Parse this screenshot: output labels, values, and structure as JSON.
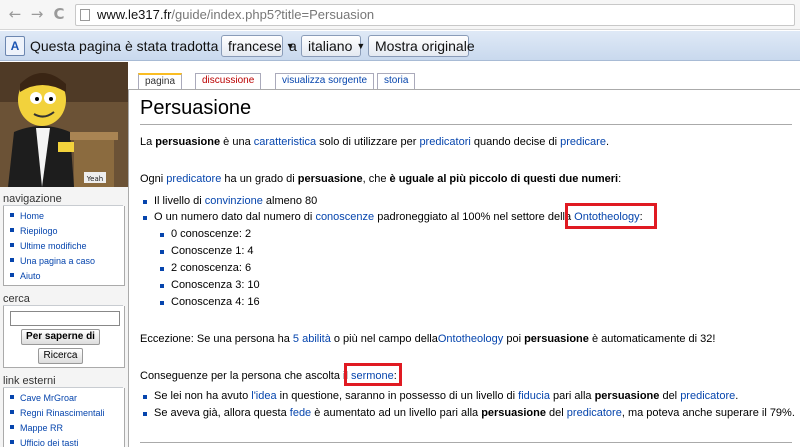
{
  "browser": {
    "back_icon": "←",
    "forward_icon": "→",
    "reload_icon": "C",
    "url_host": "www.le317.fr",
    "url_path": "/guide/index.php5?title=Persuasion"
  },
  "translate_bar": {
    "text": "Questa pagina è stata tradotta da",
    "from_lang": "francese",
    "connector": "a",
    "to_lang": "italiano",
    "show_original": "Mostra originale"
  },
  "sidebar": {
    "nav_title": "navigazione",
    "nav_items": [
      "Home",
      "Riepilogo",
      "Ultime modifiche",
      "Una pagina a caso",
      "Aiuto"
    ],
    "search_title": "cerca",
    "search_button": "Per saperne di",
    "search_go": "Ricerca",
    "links_title": "link esterni",
    "links_items": [
      "Cave MrGroar",
      "Regni Rinascimentali",
      "Mappe RR",
      "Ufficio dei tasti"
    ]
  },
  "tabs": [
    "pagina",
    "discussione",
    "visualizza sorgente",
    "storia"
  ],
  "article": {
    "title": "Persuasione",
    "intro": {
      "t1": "La ",
      "b1": "persuasione",
      "t2": " è una ",
      "l1": "caratteristica",
      "t3": " solo di utilizzare per ",
      "l2": "predicatori",
      "t4": " quando decise di ",
      "l3": "predicare",
      "t5": "."
    },
    "p2": {
      "t1": "Ogni ",
      "l1": "predicatore",
      "t2": " ha un grado di ",
      "b1": "persuasione",
      "t3": ", che ",
      "b2": "è uguale al più piccolo di questi due numeri",
      "t4": ":"
    },
    "bullet1": {
      "t1": "Il livello di ",
      "l1": "convinzione",
      "t2": " almeno 80"
    },
    "bullet2": {
      "t1": "O un numero dato dal numero di ",
      "l1": "conoscenze",
      "t2": " padroneggiato al 100% nel settore della ",
      "l2": "Ontotheology",
      "t3": ":"
    },
    "sub_items": [
      "0 conoscenze: 2",
      "Conoscenze 1: 4",
      "2 conoscenza: 6",
      "Conoscenza 3: 10",
      "Conoscenza 4: 16"
    ],
    "exception": {
      "t1": "Eccezione: Se una persona ha ",
      "l1": "5",
      "t2": " ",
      "l2": "abilità",
      "t3": " o più nel campo della",
      "l3": "Ontotheology",
      "t4": " poi ",
      "b1": "persuasione",
      "t5": " è automaticamente di 32!"
    },
    "consequences": {
      "t1": "Conseguenze per la persona che ascolta il ",
      "l1": "sermone",
      "t2": ":"
    },
    "cons1": {
      "t1": "Se lei non ha avuto ",
      "l1": "l'idea",
      "t2": " in questione, saranno in possesso di un livello di ",
      "l2": "fiducia",
      "t3": " pari alla ",
      "b1": "persuasione",
      "t4": " del ",
      "l3": "predicatore",
      "t5": "."
    },
    "cons2": {
      "t1": "Se aveva già, allora questa ",
      "l1": "fede",
      "t2": " è aumentato ad un livello pari alla ",
      "b1": "persuasione",
      "t3": " del ",
      "l2": "predicatore",
      "t4": ", ma poteva anche superare il 79%."
    }
  },
  "colors": {
    "link": "#0645ad",
    "highlight": "#e01a22",
    "tab_new": "#ba0000"
  }
}
